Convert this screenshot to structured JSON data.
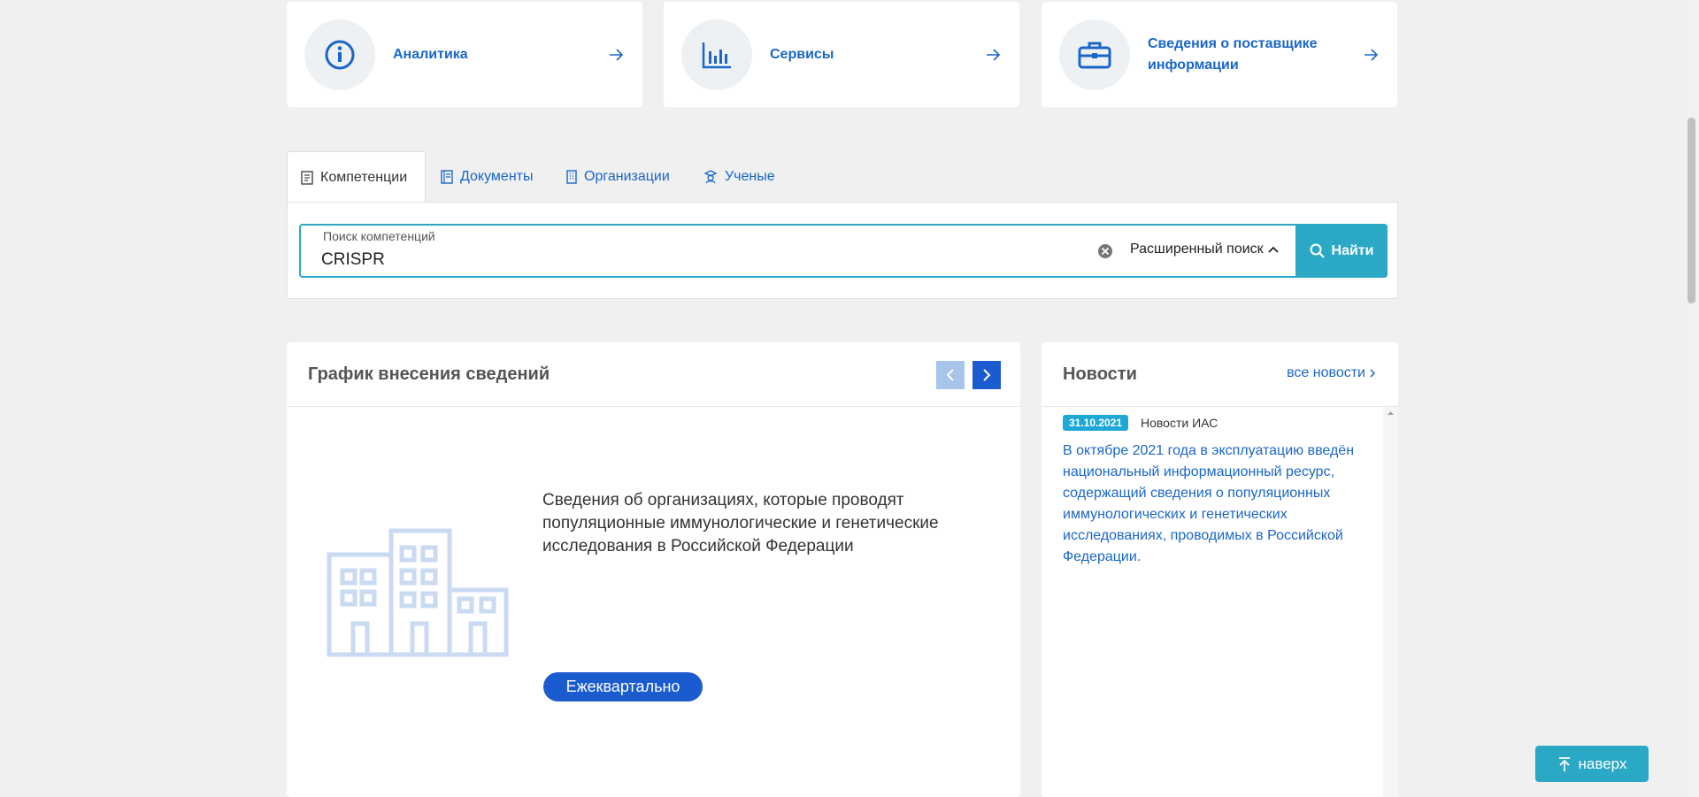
{
  "cards": [
    {
      "title": "Аналитика",
      "icon": "info-icon"
    },
    {
      "title": "Сервисы",
      "icon": "bar-chart-icon"
    },
    {
      "title": "Сведения о поставщике информации",
      "icon": "briefcase-icon"
    }
  ],
  "tabs": [
    {
      "label": "Компетенции",
      "icon": "document-icon",
      "active": true
    },
    {
      "label": "Документы",
      "icon": "book-icon",
      "active": false
    },
    {
      "label": "Организации",
      "icon": "building-icon",
      "active": false
    },
    {
      "label": "Ученые",
      "icon": "scientist-icon",
      "active": false
    }
  ],
  "search": {
    "label": "Поиск компетенций",
    "value": "CRISPR",
    "advanced_label": "Расширенный поиск",
    "find_label": "Найти"
  },
  "schedule": {
    "title": "График внесения сведений",
    "description": "Сведения об организациях, которые проводят популяционные иммунологические и генетические исследования в Российской Федерации",
    "frequency": "Ежеквартально"
  },
  "news": {
    "title": "Новости",
    "all_link": "все новости",
    "items": [
      {
        "date": "31.10.2021",
        "category": "Новости ИАС",
        "text": "В октябре 2021 года в эксплуатацию введён национальный информационный ресурс, содержащий сведения о популяционных иммунологических и генетических исследованиях, проводимых в Российской Федерации."
      }
    ]
  },
  "scroll_top_label": "наверх",
  "colors": {
    "accent": "#2aa8c6",
    "link": "#1a66c9",
    "badge": "#1a5bcf",
    "background": "#f0f0f0"
  }
}
